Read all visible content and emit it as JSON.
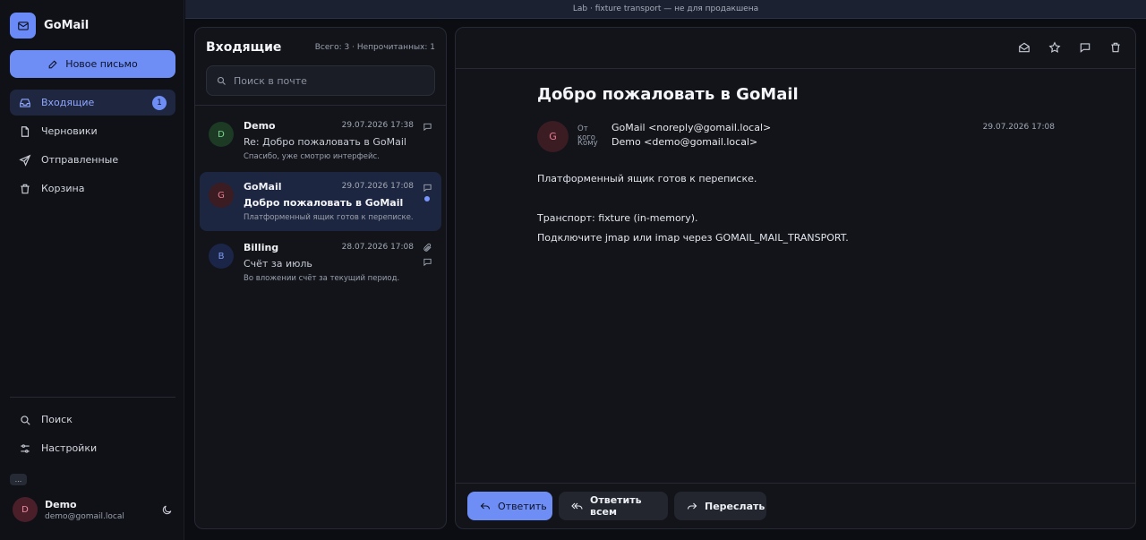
{
  "banner": "Lab · fixture transport — не для продакшена",
  "brand": {
    "name": "GoMail",
    "logo_icon": "mail-icon"
  },
  "compose": {
    "label": "Новое письмо",
    "icon": "edit-icon"
  },
  "nav": {
    "items": [
      {
        "label": "Входящие",
        "icon": "inbox-icon",
        "badge": "1",
        "active": true
      },
      {
        "label": "Черновики",
        "icon": "file-icon"
      },
      {
        "label": "Отправленные",
        "icon": "send-icon"
      },
      {
        "label": "Корзина",
        "icon": "trash-icon"
      }
    ],
    "bottom": [
      {
        "label": "Поиск",
        "icon": "search-icon"
      },
      {
        "label": "Настройки",
        "icon": "sliders-icon"
      }
    ],
    "more": "..."
  },
  "user": {
    "initial": "D",
    "name": "Demo",
    "email": "demo@gomail.local"
  },
  "list": {
    "title": "Входящие",
    "stats": "Всего: 3 · Непрочитанных: 1",
    "search_placeholder": "Поиск в почте",
    "messages": [
      {
        "initial": "D",
        "from": "Demo",
        "date": "29.07.2026 17:38",
        "subject": "Re: Добро пожаловать в GoMail",
        "preview": "Спасибо, уже смотрю интерфейс."
      },
      {
        "initial": "G",
        "from": "GoMail",
        "date": "29.07.2026 17:08",
        "subject": "Добро пожаловать в GoMail",
        "preview": "Платформенный ящик готов к переписке.",
        "unread": true,
        "selected": true
      },
      {
        "initial": "B",
        "from": "Billing",
        "date": "28.07.2026 17:08",
        "subject": "Счёт за июль",
        "preview": "Во вложении счёт за текущий период.",
        "attachment": true
      }
    ]
  },
  "reader": {
    "subject": "Добро пожаловать в GoMail",
    "from_label": "От кого",
    "from": "GoMail <noreply@gomail.local>",
    "to_label": "Кому",
    "to": "Demo <demo@gomail.local>",
    "date": "29.07.2026 17:08",
    "avatar_initial": "G",
    "body": {
      "p1": "Платформенный ящик готов к переписке.",
      "p2": "Транспорт: fixture (in-memory).",
      "p3": "Подключите jmap или imap через GOMAIL_MAIL_TRANSPORT."
    },
    "actions": {
      "reply": "Ответить",
      "reply_all": "Ответить всем",
      "forward": "Переслать"
    }
  },
  "colors": {
    "accent": "#6e8ef5",
    "background": "#0b0d12",
    "panel": "#12141a"
  }
}
